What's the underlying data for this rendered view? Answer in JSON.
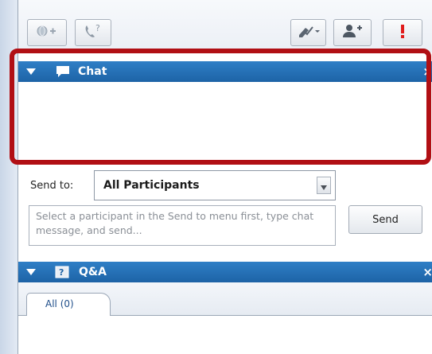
{
  "colors": {
    "header_blue": "#1d63a6",
    "highlight_red": "#b10f14",
    "alert_red": "#e01b1b"
  },
  "toolbar": {
    "buttons": [
      {
        "name": "status-button",
        "icon": "globe-plus-icon"
      },
      {
        "name": "call-help-button",
        "icon": "phone-question-icon"
      },
      {
        "name": "annotate-button",
        "icon": "pen-check-icon"
      },
      {
        "name": "add-participant-button",
        "icon": "person-plus-icon"
      },
      {
        "name": "alert-button",
        "icon": "exclamation-icon"
      }
    ]
  },
  "chat": {
    "title": "Chat",
    "close": "×"
  },
  "send_to": {
    "label": "Send to:",
    "selected": "All Participants"
  },
  "message": {
    "placeholder": "Select a participant in the Send to menu first, type chat message, and send..."
  },
  "send_button": "Send",
  "qa": {
    "title": "Q&A",
    "close": "×",
    "tabs": [
      {
        "label": "All (0)"
      }
    ]
  }
}
